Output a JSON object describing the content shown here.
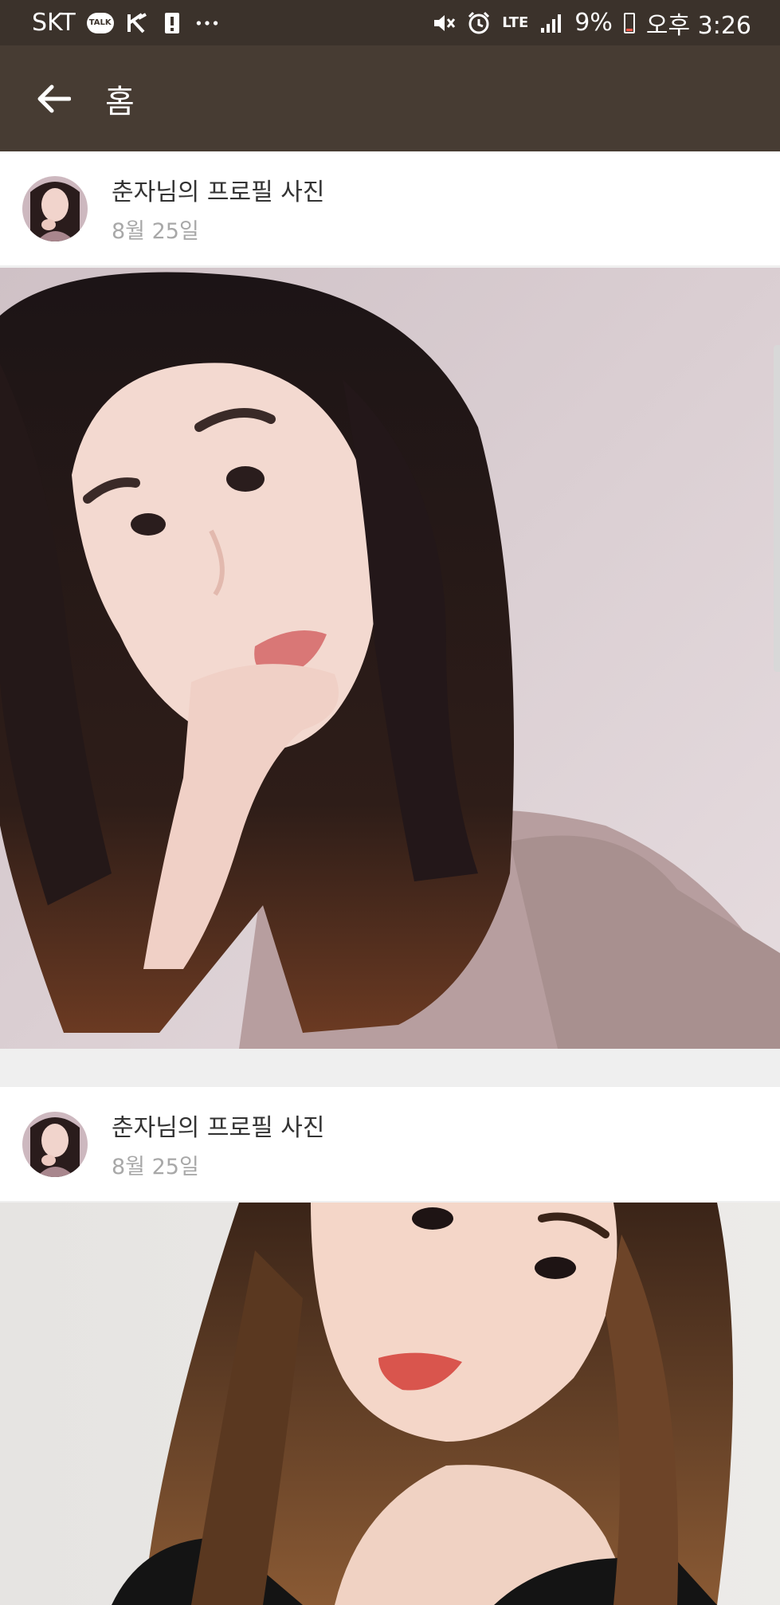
{
  "status_bar": {
    "carrier": "SKT",
    "talk_badge": "TALK",
    "network": "LTE",
    "battery": "9%",
    "time": "오후 3:26",
    "icons": [
      "kakaotalk-icon",
      "k-icon",
      "alert-icon",
      "more-icon",
      "mute-icon",
      "alarm-icon",
      "signal-icon",
      "battery-icon"
    ]
  },
  "app_bar": {
    "title": "홈",
    "back_icon": "arrow-left-icon"
  },
  "posts": [
    {
      "title": "춘자님의 프로필 사진",
      "date": "8월 25일"
    },
    {
      "title": "춘자님의 프로필 사진",
      "date": "8월 25일"
    }
  ],
  "colors": {
    "status_bar": "#3b322b",
    "app_bar": "#473c33",
    "background": "#efefef"
  }
}
